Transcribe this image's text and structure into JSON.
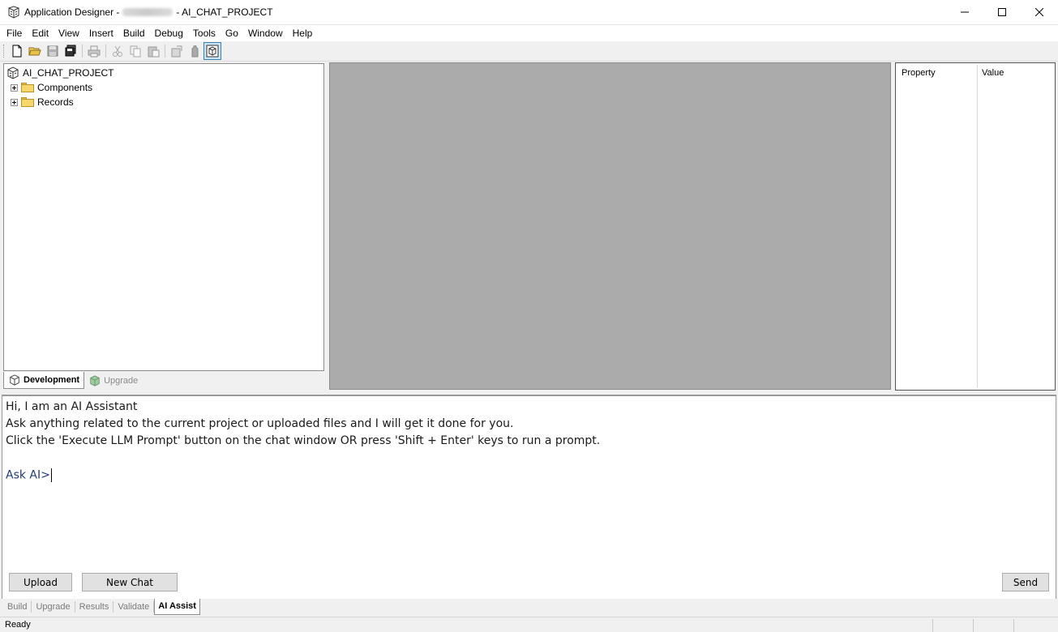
{
  "window": {
    "app_name": "Application Designer -",
    "project_title": "- AI_CHAT_PROJECT"
  },
  "menu": [
    "File",
    "Edit",
    "View",
    "Insert",
    "Build",
    "Debug",
    "Tools",
    "Go",
    "Window",
    "Help"
  ],
  "tree": {
    "root": "AI_CHAT_PROJECT",
    "children": [
      "Components",
      "Records"
    ]
  },
  "left_tabs": {
    "development": "Development",
    "upgrade": "Upgrade"
  },
  "properties": {
    "col_property": "Property",
    "col_value": "Value"
  },
  "chat": {
    "greeting": "Hi, I am an AI Assistant",
    "line2": "Ask anything related to the current project or uploaded files and I will get it done for you.",
    "line3": "Click the 'Execute LLM Prompt' button on the chat window OR press 'Shift + Enter' keys to run a prompt.",
    "prompt": "Ask AI>",
    "upload_label": "Upload",
    "new_chat_label": "New Chat",
    "send_label": "Send"
  },
  "bottom_tabs": [
    "Build",
    "Upgrade",
    "Results",
    "Validate",
    "AI Assist"
  ],
  "status": {
    "text": "Ready"
  }
}
